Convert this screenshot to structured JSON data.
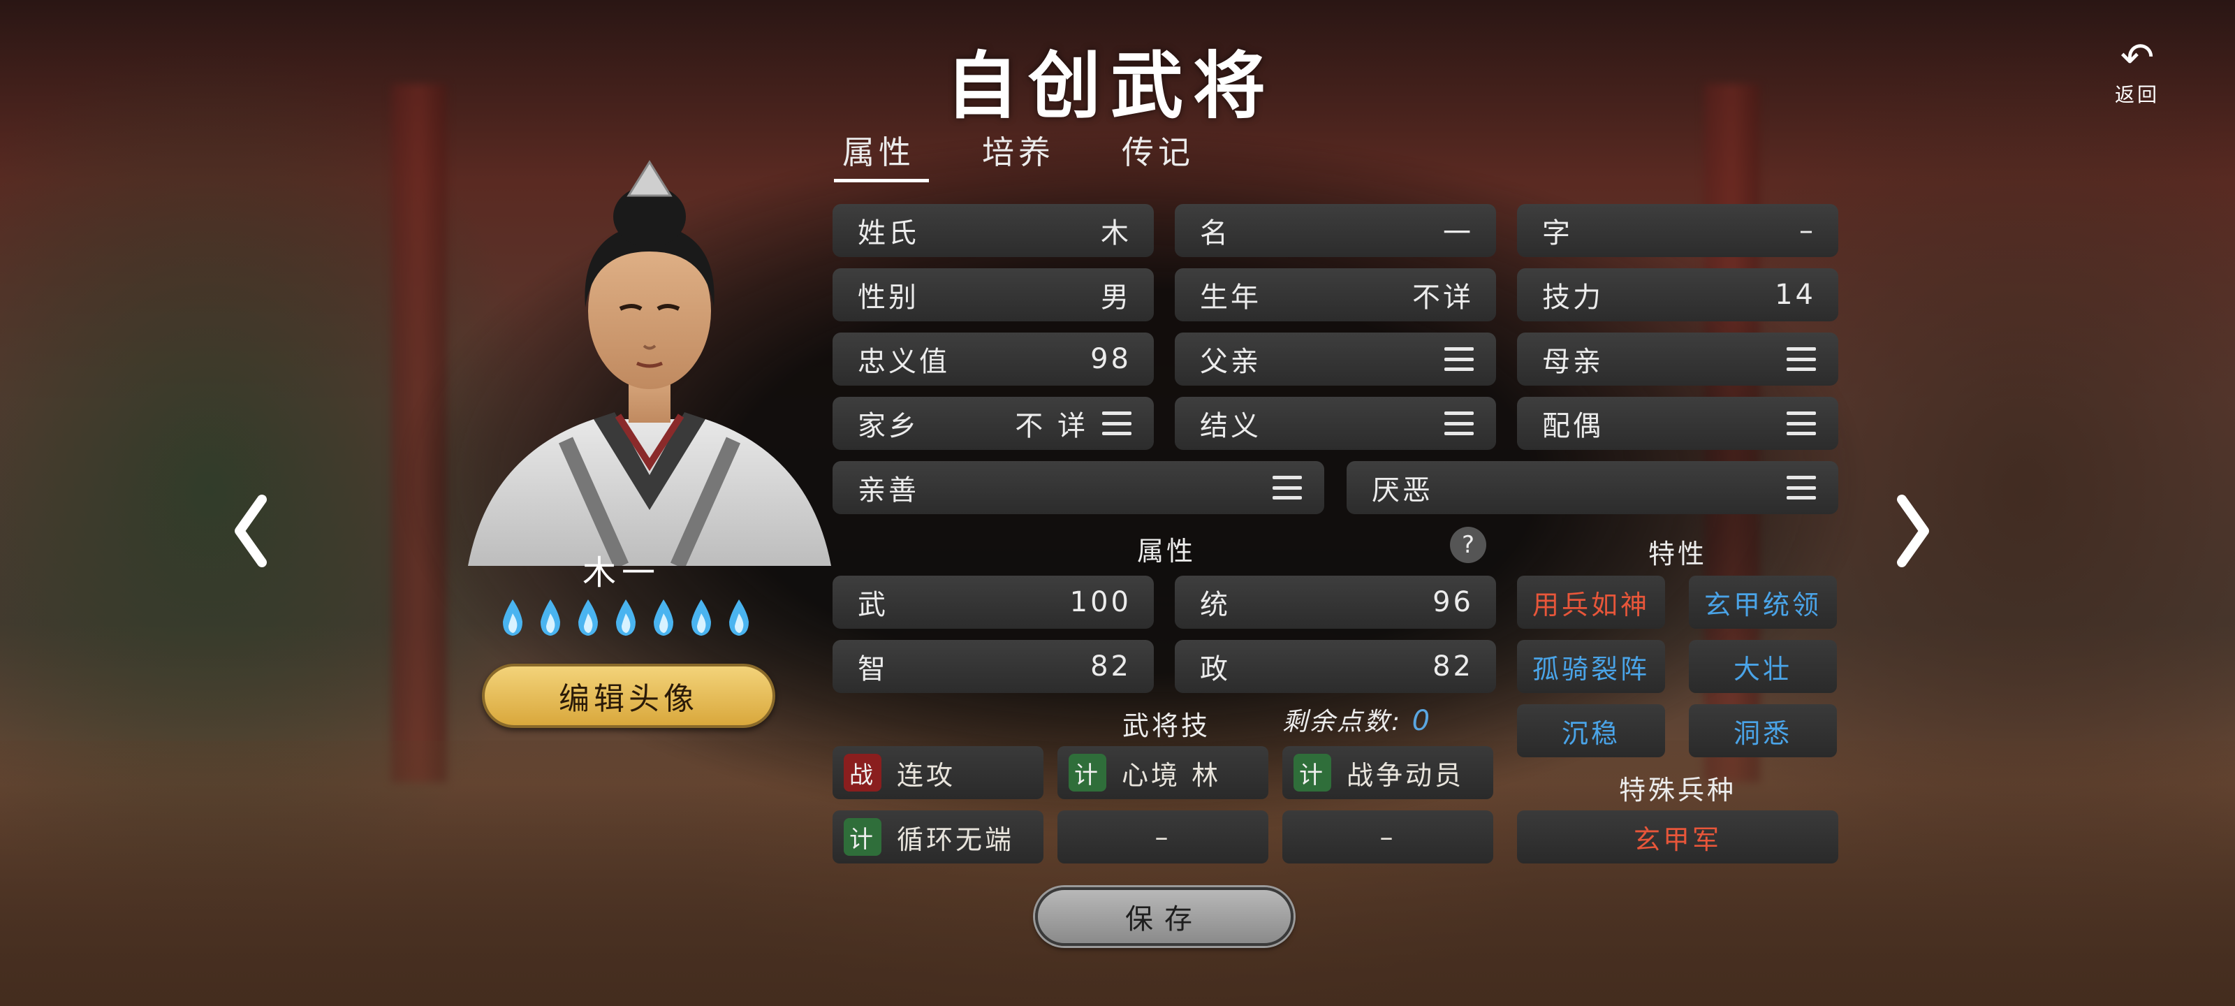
{
  "title": "自创武将",
  "back": {
    "icon": "undo-arrow-icon",
    "label": "返回"
  },
  "tabs": [
    {
      "label": "属性",
      "active": true
    },
    {
      "label": "培养",
      "active": false
    },
    {
      "label": "传记",
      "active": false
    }
  ],
  "portrait": {
    "name": "木一",
    "flame_count": 7,
    "flame_color": "#4ab4f0",
    "edit_label": "编辑头像"
  },
  "basic": {
    "surname": {
      "label": "姓氏",
      "value": "木"
    },
    "given_name": {
      "label": "名",
      "value": "一"
    },
    "courtesy": {
      "label": "字",
      "value": "–"
    },
    "gender": {
      "label": "性别",
      "value": "男"
    },
    "birth_year": {
      "label": "生年",
      "value": "不详"
    },
    "skill_power": {
      "label": "技力",
      "value": "14"
    },
    "loyalty": {
      "label": "忠义值",
      "value": "98"
    },
    "father": {
      "label": "父亲"
    },
    "mother": {
      "label": "母亲"
    },
    "hometown": {
      "label": "家乡",
      "value": "不 详"
    },
    "sworn": {
      "label": "结义"
    },
    "spouse": {
      "label": "配偶"
    },
    "friendly": {
      "label": "亲善"
    },
    "dislike": {
      "label": "厌恶"
    }
  },
  "attributes": {
    "header": "属性",
    "help": "?",
    "war": {
      "label": "武",
      "value": "100"
    },
    "command": {
      "label": "统",
      "value": "96"
    },
    "intellect": {
      "label": "智",
      "value": "82"
    },
    "politics": {
      "label": "政",
      "value": "82"
    }
  },
  "traits": {
    "header": "特性",
    "items": [
      {
        "label": "用兵如神",
        "color": "#e8563a"
      },
      {
        "label": "玄甲统领",
        "color": "#4aa4e8"
      },
      {
        "label": "孤骑裂阵",
        "color": "#4aa4e8"
      },
      {
        "label": "大壮",
        "color": "#4aa4e8"
      },
      {
        "label": "沉稳",
        "color": "#4aa4e8"
      },
      {
        "label": "洞悉",
        "color": "#4aa4e8"
      }
    ]
  },
  "skills": {
    "header": "武将技",
    "remaining_label": "剩余点数:",
    "remaining_value": "0",
    "items": [
      {
        "badge": "战",
        "label": "连攻"
      },
      {
        "badge": "计",
        "label": "心境 林"
      },
      {
        "badge": "计",
        "label": "战争动员"
      },
      {
        "badge": "计",
        "label": "循环无端"
      },
      {
        "badge": "",
        "label": "–"
      },
      {
        "badge": "",
        "label": "–"
      }
    ]
  },
  "special_troop": {
    "header": "特殊兵种",
    "value": "玄甲军",
    "color": "#e8563a"
  },
  "save_label": "保存"
}
